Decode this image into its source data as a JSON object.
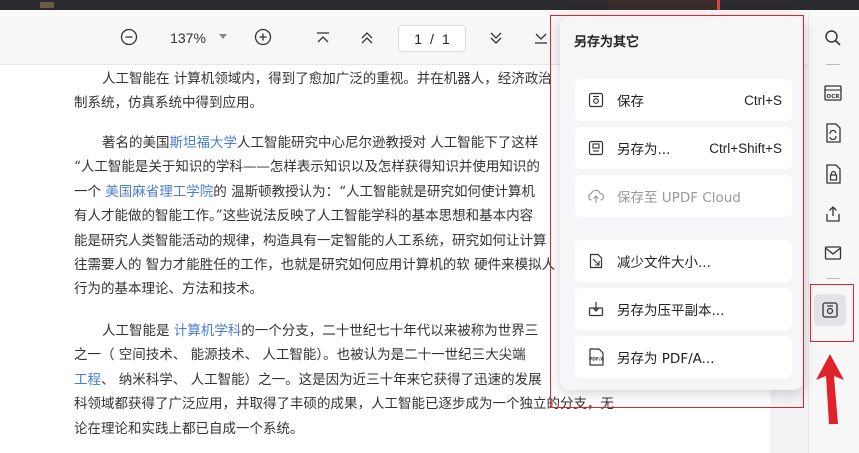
{
  "toolbar": {
    "zoom_value": "137%",
    "page_current": "1",
    "page_separator": "/",
    "page_total": "1"
  },
  "document": {
    "paragraphs": [
      [
        "人工智能在 计算机领域内，得到了愈加广泛的重视。并在机器人，经济政治",
        "制系统，仿真系统中得到应用。"
      ],
      [
        "著名的美国",
        "斯坦福大学",
        "人工智能研究中心尼尔逊教授对 人工智能下了这样",
        "“人工智能是关于知识的学科——怎样表示知识以及怎样获得知识并使用知识的",
        "一个 ",
        "美国麻省理工学院",
        "的 温斯顿教授认为：“人工智能就是研究如何使计算机",
        "有人才能做的智能工作。”这些说法反映了人工智能学科的基本思想和基本内容",
        "能是研究人类智能活动的规律，构造具有一定智能的人工系统，研究如何让计算",
        "往需要人的 智力才能胜任的工作，也就是研究如何应用计算机的软 硬件来模拟人",
        "行为的基本理论、方法和技术。"
      ],
      [
        "人工智能是 ",
        "计算机学科",
        "的一个分支，二十世纪七十年代以来被称为世界三",
        "之一（ 空间技术、 能源技术、 人工智能）。也被认为是二十一世纪三大尖端",
        "工程",
        "、 纳米科学、 人工智能）之一。这是因为近三十年来它获得了迅速的发展",
        "科领域都获得了广泛应用，并取得了丰硕的成果，人工智能已逐步成为一个独立的分支，无",
        "论在理论和实践上都已自成一个系统。"
      ]
    ]
  },
  "popup": {
    "title": "另存为其它",
    "items": [
      {
        "label": "保存",
        "shortcut": "Ctrl+S",
        "icon": "save-icon"
      },
      {
        "label": "另存为...",
        "shortcut": "Ctrl+Shift+S",
        "icon": "save-as-icon"
      },
      {
        "label": "保存至 UPDF Cloud",
        "shortcut": "",
        "icon": "cloud-icon",
        "disabled": true
      },
      {
        "label": "减少文件大小...",
        "shortcut": "",
        "icon": "compress-icon"
      },
      {
        "label": "另存为压平副本...",
        "shortcut": "",
        "icon": "flatten-icon"
      },
      {
        "label": "另存为 PDF/A...",
        "shortcut": "",
        "icon": "pdfa-icon"
      }
    ]
  },
  "sidebar": {
    "ocr_label": "OCR",
    "pdfa_label": "PDF/A"
  },
  "colors": {
    "link": "#4a7bd6",
    "annotation_red": "#e0222a",
    "popup_bg": "#f6f6f8"
  }
}
